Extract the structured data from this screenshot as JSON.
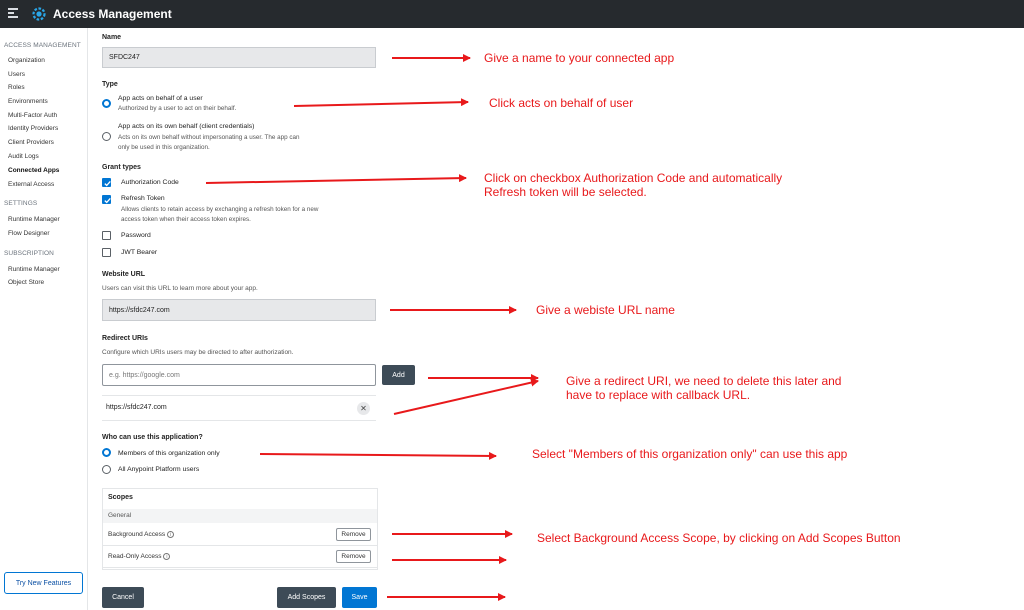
{
  "app": {
    "title": "Access Management"
  },
  "sidebar": {
    "sections": [
      {
        "title": "ACCESS MANAGEMENT",
        "items": [
          "Organization",
          "Users",
          "Roles",
          "Environments",
          "Multi-Factor Auth",
          "Identity Providers",
          "Client Providers",
          "Audit Logs",
          "Connected Apps",
          "External Access"
        ]
      },
      {
        "title": "SETTINGS",
        "items": [
          "Runtime Manager",
          "Flow Designer"
        ]
      },
      {
        "title": "SUBSCRIPTION",
        "items": [
          "Runtime Manager",
          "Object Store"
        ]
      }
    ],
    "active_item": "Connected Apps",
    "try_button": "Try New Features"
  },
  "form": {
    "name": {
      "label": "Name",
      "value": "SFDC247"
    },
    "type": {
      "label": "Type",
      "options": [
        {
          "title": "App acts on behalf of a user",
          "desc": "Authorized by a user to act on their behalf.",
          "selected": true
        },
        {
          "title": "App acts on its own behalf (client credentials)",
          "desc1": "Acts on its own behalf without impersonating a user. The app can",
          "desc2": "only be used in this organization.",
          "selected": false
        }
      ]
    },
    "grant_types": {
      "label": "Grant types",
      "options": [
        {
          "title": "Authorization Code",
          "checked": true
        },
        {
          "title": "Refresh Token",
          "desc1": "Allows clients to retain access by exchanging a refresh token for a new",
          "desc2": "access token when their access token expires.",
          "checked": true
        },
        {
          "title": "Password",
          "checked": false
        },
        {
          "title": "JWT Bearer",
          "checked": false
        }
      ]
    },
    "website_url": {
      "label": "Website URL",
      "help": "Users can visit this URL to learn more about your app.",
      "value": "https://sfdc247.com"
    },
    "redirect_uris": {
      "label": "Redirect URIs",
      "help": "Configure which URIs users may be directed to after authorization.",
      "placeholder": "e.g. https://google.com",
      "add_label": "Add",
      "items": [
        "https://sfdc247.com"
      ],
      "remove_glyph": "✕"
    },
    "audience": {
      "label": "Who can use this application?",
      "options": [
        {
          "title": "Members of this organization only",
          "selected": true
        },
        {
          "title": "All Anypoint Platform users",
          "selected": false
        }
      ]
    },
    "scopes": {
      "label": "Scopes",
      "group": "General",
      "items": [
        {
          "name": "Background Access",
          "remove_label": "Remove"
        },
        {
          "name": "Read-Only Access",
          "remove_label": "Remove"
        }
      ],
      "info_glyph": "i"
    },
    "buttons": {
      "cancel": "Cancel",
      "add_scopes": "Add Scopes",
      "save": "Save"
    }
  },
  "annotations": {
    "name": "Give a name to your connected app",
    "type": "Click acts on behalf of user",
    "grant_line1": "Click on checkbox Authorization Code and automatically",
    "grant_line2": "Refresh token will be selected.",
    "website": "Give a webiste URL name",
    "redirect_line1": "Give a redirect URI, we need to delete this later and",
    "redirect_line2": "have to replace with callback URL.",
    "audience": "Select \"Members of this organization only\" can use this app",
    "scopes": "Select Background Access Scope, by clicking on Add Scopes Button"
  },
  "colors": {
    "accent": "#0176d3",
    "annotation": "#e8191b",
    "topbar": "#262a2e"
  }
}
